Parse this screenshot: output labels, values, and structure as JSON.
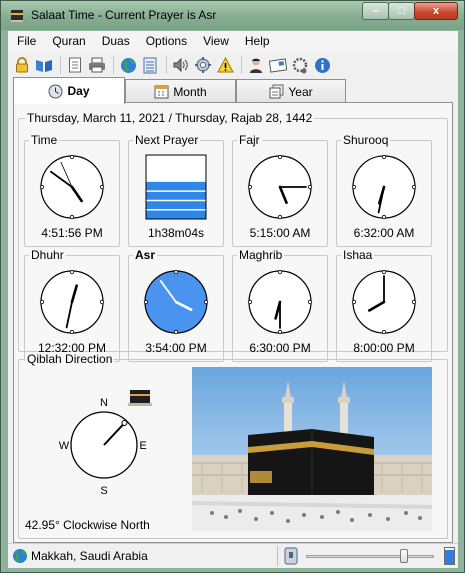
{
  "window": {
    "title": "Salaat Time - Current Prayer is Asr",
    "min_label": "–",
    "max_label": "□",
    "close_label": "x"
  },
  "menu": [
    "File",
    "Quran",
    "Duas",
    "Options",
    "View",
    "Help"
  ],
  "toolbar": {
    "icons": [
      "lock-icon",
      "book-icon",
      "document-icon",
      "printer-icon",
      "globe-icon",
      "calendar-icon",
      "speaker-icon",
      "settings-icon",
      "warning-icon",
      "person-icon",
      "postcard-icon",
      "tasbih-icon",
      "info-icon"
    ]
  },
  "tabs": [
    {
      "label": "Day",
      "active": true
    },
    {
      "label": "Month",
      "active": false
    },
    {
      "label": "Year",
      "active": false
    }
  ],
  "day": {
    "date_heading": "Thursday, March 11, 2021 / Thursday, Rajab 28, 1442",
    "prayers": [
      {
        "name": "Time",
        "value": "4:51:56 PM",
        "hour": 16,
        "minute": 51,
        "second": 56
      },
      {
        "name": "Next Prayer",
        "value": "1h38m04s",
        "remaining_fraction": 0.58
      },
      {
        "name": "Fajr",
        "value": "5:15:00 AM",
        "hour": 5,
        "minute": 15
      },
      {
        "name": "Shurooq",
        "value": "6:32:00 AM",
        "hour": 6,
        "minute": 32
      },
      {
        "name": "Dhuhr",
        "value": "12:32:00 PM",
        "hour": 12,
        "minute": 32
      },
      {
        "name": "Asr",
        "value": "3:54:00 PM",
        "hour": 15,
        "minute": 54,
        "current": true
      },
      {
        "name": "Maghrib",
        "value": "6:30:00 PM",
        "hour": 18,
        "minute": 30
      },
      {
        "name": "Ishaa",
        "value": "8:00:00 PM",
        "hour": 20,
        "minute": 0
      }
    ],
    "qiblah": {
      "label": "Qiblah Direction",
      "north": "N",
      "east": "E",
      "south": "S",
      "west": "W",
      "bearing_degrees": 42.95,
      "text": "42.95° Clockwise North"
    }
  },
  "status": {
    "location": "Makkah, Saudi Arabia",
    "volume_fraction": 0.78,
    "level_fraction": 0.85
  },
  "colors": {
    "accent_blue": "#3b8ef0",
    "current_clock_fill": "#4a94f0",
    "next_prayer_fill": "#2e86e8"
  }
}
